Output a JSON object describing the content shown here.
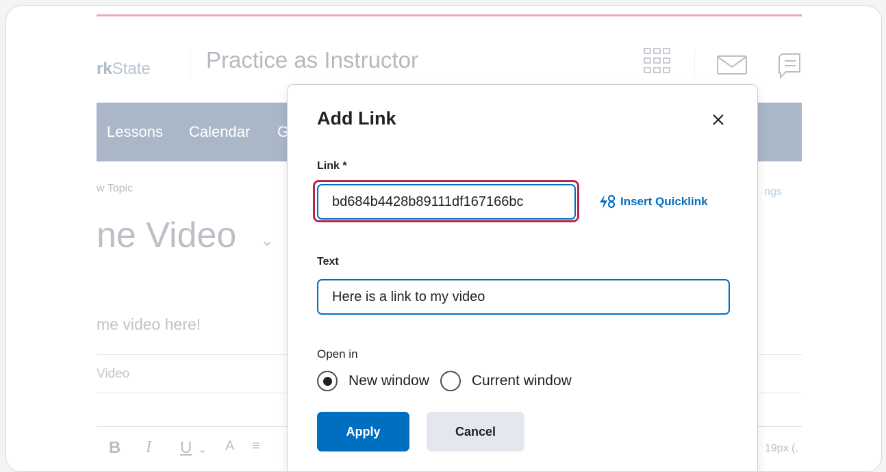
{
  "app": {
    "logo_bold": "rk",
    "logo_rest": "State",
    "course_title": "Practice as Instructor",
    "nav_items": [
      "Lessons",
      "Calendar",
      "G"
    ],
    "breadcrumb": "w Topic",
    "settings_fragment": "ngs",
    "topic_title": "ne Video",
    "body_text": "me video here!",
    "video_label": "Video",
    "toolbar": {
      "bold": "B",
      "italic": "I",
      "underline": "U",
      "size_text": "19px (."
    }
  },
  "dialog": {
    "title": "Add Link",
    "link_label": "Link *",
    "link_value": "bd684b4428b89111df167166bc",
    "quicklink_label": "Insert Quicklink",
    "text_label": "Text",
    "text_value": "Here is a link to my video",
    "open_in_label": "Open in",
    "open_in_options": [
      {
        "label": "New window",
        "selected": true
      },
      {
        "label": "Current window",
        "selected": false
      }
    ],
    "apply_label": "Apply",
    "cancel_label": "Cancel"
  },
  "colors": {
    "accent": "#006fbf",
    "highlight": "#b3294a",
    "navbar": "#aab7c9"
  }
}
